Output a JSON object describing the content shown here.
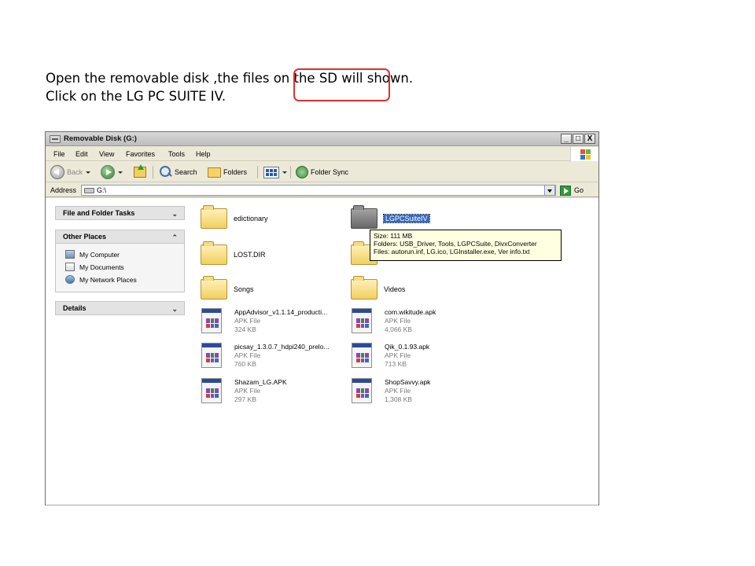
{
  "caption": {
    "line1": "Open the removable disk ,the files on the SD will shown.",
    "line2": "Click on the LG PC SUITE IV."
  },
  "window": {
    "title": "Removable Disk (G:)",
    "controls": {
      "minimize": "_",
      "maximize": "□",
      "close": "X"
    }
  },
  "menu": {
    "items": [
      "File",
      "Edit",
      "View",
      "Favorites",
      "Tools",
      "Help"
    ]
  },
  "toolbar": {
    "back_label": "Back",
    "search_label": "Search",
    "folders_label": "Folders",
    "folder_sync_label": "Folder Sync"
  },
  "address": {
    "label": "Address",
    "value": "G:\\",
    "go_label": "Go"
  },
  "task_pane": {
    "file_folder_tasks": {
      "title": "File and Folder Tasks",
      "chevron": "⌄"
    },
    "other_places": {
      "title": "Other Places",
      "chevron": "⌃",
      "items": [
        "My Computer",
        "My Documents",
        "My Network Places"
      ]
    },
    "details": {
      "title": "Details",
      "chevron": "⌄"
    }
  },
  "folders": [
    {
      "name": "edictionary",
      "selected": false
    },
    {
      "name": "LGPCSuiteIV",
      "selected": true
    },
    {
      "name": "LOST.DIR",
      "selected": false
    },
    {
      "name": "Songs",
      "selected": false
    },
    {
      "name": "Videos",
      "selected": false
    }
  ],
  "files": [
    {
      "name": "AppAdvisor_v1.1.14_producti...",
      "type": "APK File",
      "size": "324 KB"
    },
    {
      "name": "com.wikitude.apk",
      "type": "APK File",
      "size": "4,066 KB"
    },
    {
      "name": "picsay_1.3.0.7_hdpi240_prelo...",
      "type": "APK File",
      "size": "760 KB"
    },
    {
      "name": "Qik_0.1.93.apk",
      "type": "APK File",
      "size": "713 KB"
    },
    {
      "name": "Shazam_LG.APK",
      "type": "APK File",
      "size": "297 KB"
    },
    {
      "name": "ShopSavvy.apk",
      "type": "APK File",
      "size": "1,308 KB"
    }
  ],
  "tooltip": {
    "size": "Size: 111 MB",
    "folders": "Folders: USB_Driver, Tools, LGPCSuite, DivxConverter",
    "files": "Files: autorun.inf, LG.ico, LGInstaller.exe, Ver info.txt"
  },
  "colors": {
    "selection": "#316ac5",
    "highlight_ring": "#e03030",
    "tooltip_bg": "#ffffe1",
    "window_bg": "#ece9d8"
  }
}
